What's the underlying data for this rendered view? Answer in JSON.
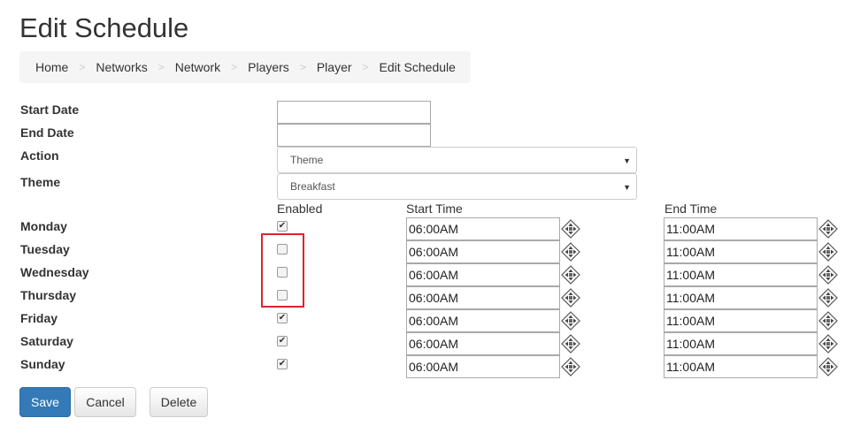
{
  "page": {
    "title": "Edit Schedule"
  },
  "breadcrumb": [
    "Home",
    "Networks",
    "Network",
    "Players",
    "Player",
    "Edit Schedule"
  ],
  "breadcrumb_separator": ">",
  "form": {
    "start_date": {
      "label": "Start Date",
      "value": ""
    },
    "end_date": {
      "label": "End Date",
      "value": ""
    },
    "action": {
      "label": "Action",
      "value": "Theme"
    },
    "theme": {
      "label": "Theme",
      "value": "Breakfast"
    }
  },
  "schedule": {
    "headers": {
      "enabled": "Enabled",
      "start_time": "Start Time",
      "end_time": "End Time"
    },
    "days": [
      {
        "name": "Monday",
        "enabled": true,
        "start": "06:00AM",
        "end": "11:00AM"
      },
      {
        "name": "Tuesday",
        "enabled": false,
        "start": "06:00AM",
        "end": "11:00AM"
      },
      {
        "name": "Wednesday",
        "enabled": false,
        "start": "06:00AM",
        "end": "11:00AM"
      },
      {
        "name": "Thursday",
        "enabled": false,
        "start": "06:00AM",
        "end": "11:00AM"
      },
      {
        "name": "Friday",
        "enabled": true,
        "start": "06:00AM",
        "end": "11:00AM"
      },
      {
        "name": "Saturday",
        "enabled": true,
        "start": "06:00AM",
        "end": "11:00AM"
      },
      {
        "name": "Sunday",
        "enabled": true,
        "start": "06:00AM",
        "end": "11:00AM"
      }
    ]
  },
  "buttons": {
    "save": "Save",
    "cancel": "Cancel",
    "delete": "Delete"
  },
  "colors": {
    "primary": "#337ab7",
    "highlight": "#d9262c",
    "breadcrumb_bg": "#f5f5f5"
  }
}
